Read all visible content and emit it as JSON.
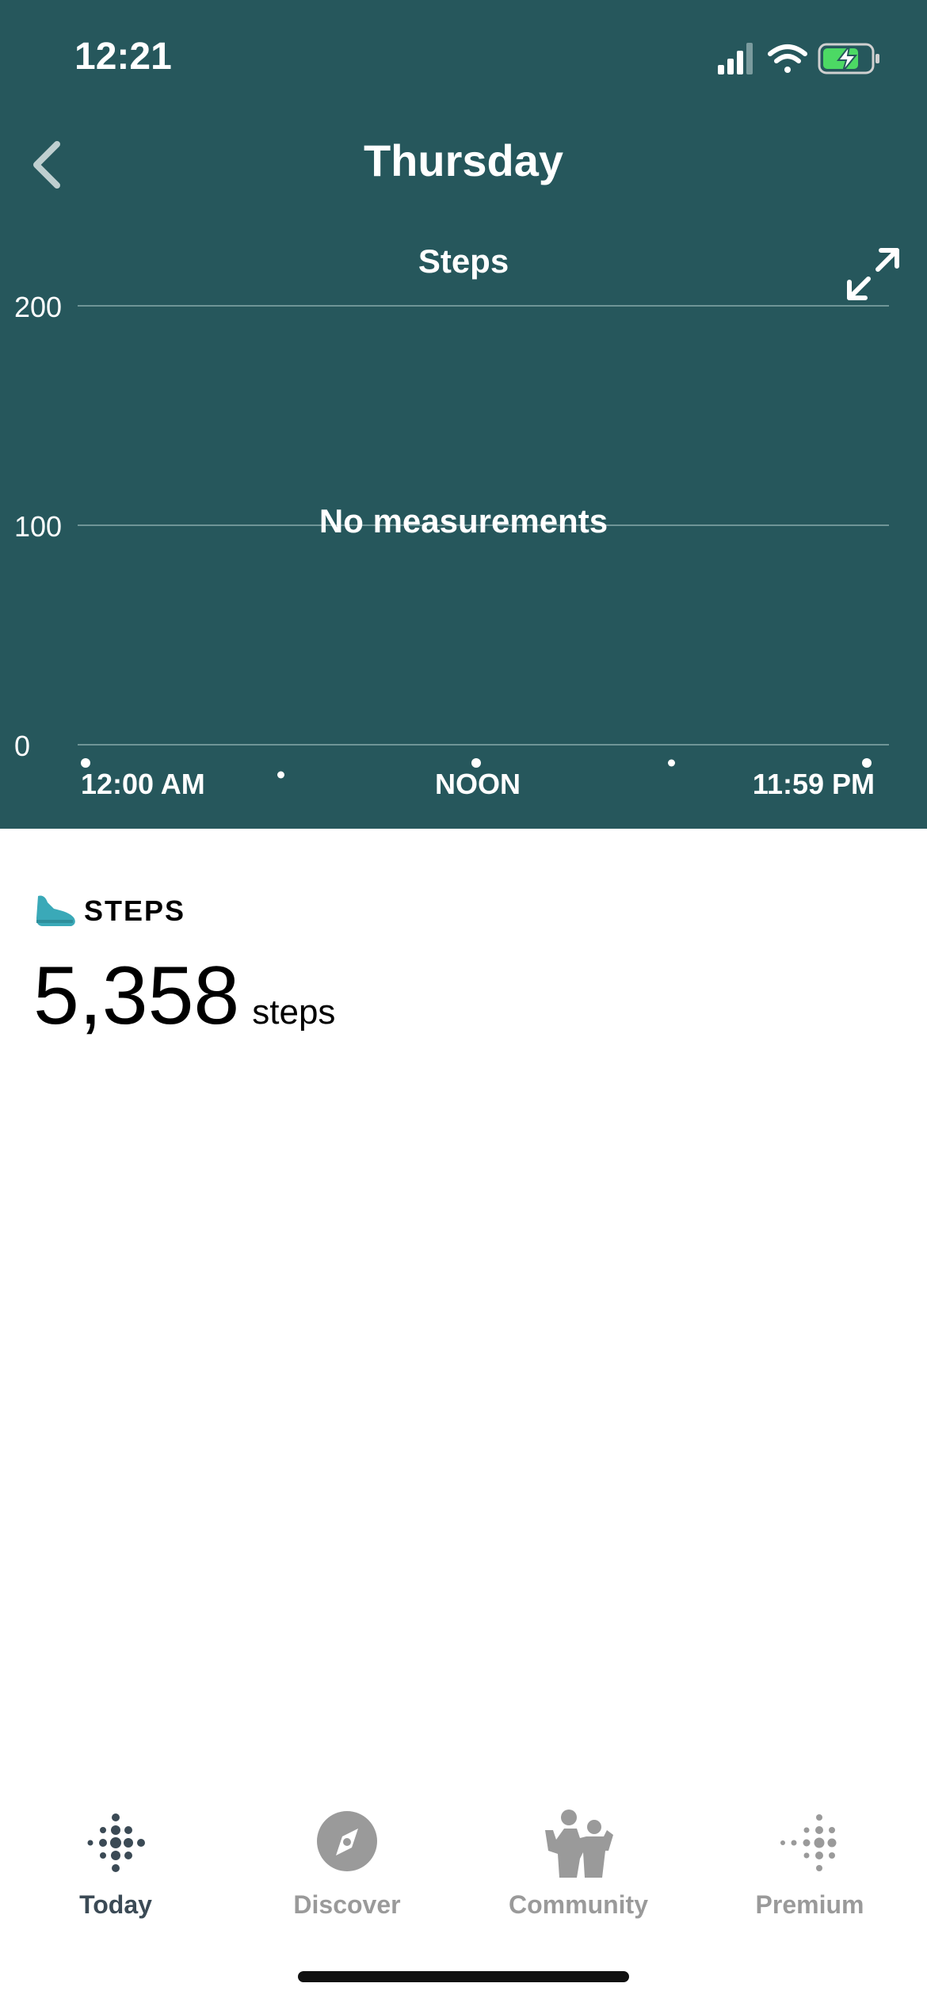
{
  "status_bar": {
    "time": "12:21"
  },
  "header": {
    "title": "Thursday"
  },
  "chart_data": {
    "type": "bar",
    "title": "Steps",
    "y_ticks": [
      "200",
      "100",
      "0"
    ],
    "ylim": [
      0,
      200
    ],
    "x_ticks": [
      "12:00 AM",
      "NOON",
      "11:59 PM"
    ],
    "values": [],
    "empty_message": "No measurements",
    "grid": true
  },
  "summary": {
    "label": "STEPS",
    "value": "5,358",
    "unit": "steps"
  },
  "tabbar": {
    "items": [
      {
        "label": "Today",
        "icon": "fitbit-dots-icon",
        "active": true
      },
      {
        "label": "Discover",
        "icon": "compass-icon",
        "active": false
      },
      {
        "label": "Community",
        "icon": "community-icon",
        "active": false
      },
      {
        "label": "Premium",
        "icon": "premium-dots-icon",
        "active": false
      }
    ]
  },
  "colors": {
    "header_bg": "#26575c",
    "accent": "#3aa9b8",
    "tab_active": "#3b4a55",
    "tab_inactive": "#9a9a9a"
  }
}
